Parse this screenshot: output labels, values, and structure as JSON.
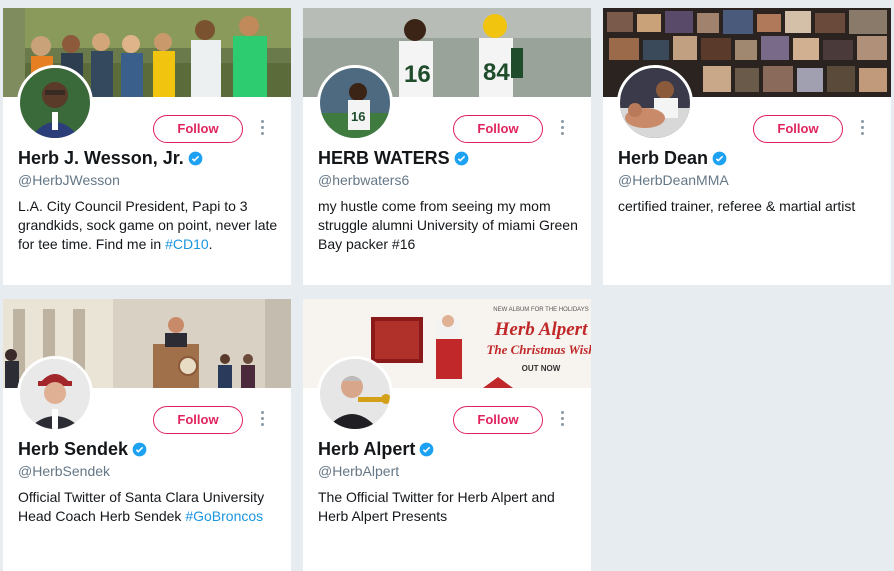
{
  "colors": {
    "page_bg": "#e6ecf0",
    "follow_accent": "#e0245e",
    "verified_blue": "#1da1f2",
    "link_blue": "#1b95e0",
    "handle_gray": "#657786"
  },
  "cards": [
    {
      "name": "Herb J. Wesson, Jr.",
      "handle": "@HerbJWesson",
      "follow_label": "Follow",
      "verified": true,
      "bio_text": "L.A. City Council President, Papi to 3 grandkids, sock game on point, never late for tee time. Find me in ",
      "bio_hashtag": "#CD10",
      "bio_suffix": "."
    },
    {
      "name": "HERB WATERS",
      "handle": "@herbwaters6",
      "follow_label": "Follow",
      "verified": true,
      "bio_text": "my hustle come from seeing my mom struggle alumni University of miami Green Bay packer #16"
    },
    {
      "name": "Herb Dean",
      "handle": "@HerbDeanMMA",
      "follow_label": "Follow",
      "verified": true,
      "bio_text": "certified trainer, referee & martial artist"
    },
    {
      "name": "Herb Sendek",
      "handle": "@HerbSendek",
      "follow_label": "Follow",
      "verified": true,
      "bio_text": "Official Twitter of Santa Clara University Head Coach Herb Sendek ",
      "bio_hashtag": "#GoBroncos"
    },
    {
      "name": "Herb Alpert",
      "handle": "@HerbAlpert",
      "follow_label": "Follow",
      "verified": true,
      "bio_text": "The Official Twitter for Herb Alpert and Herb Alpert Presents"
    }
  ],
  "banner_texts": {
    "alpert_new_album": "NEW ALBUM FOR THE HOLIDAYS",
    "alpert_title": "Herb Alpert",
    "alpert_subtitle": "The Christmas Wish",
    "alpert_out_now": "OUT NOW"
  },
  "icons": [
    "verified-icon",
    "more-icon"
  ]
}
